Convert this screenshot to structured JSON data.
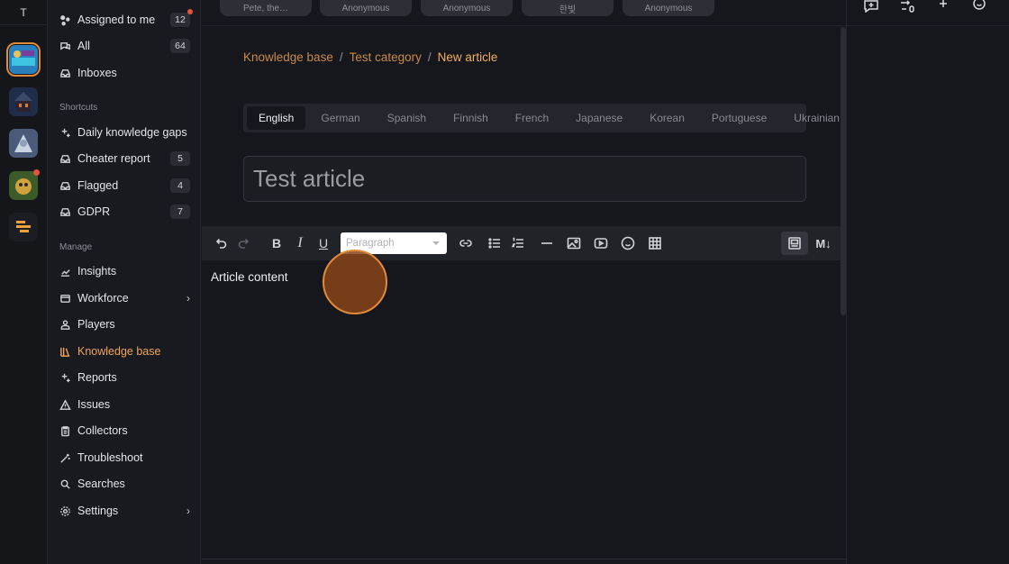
{
  "rail": {
    "top_label": "T",
    "workspaces": [
      {
        "name": "workspace-1",
        "colors": [
          "#2a7fbf",
          "#3ec3e0"
        ],
        "active": true
      },
      {
        "name": "workspace-2",
        "colors": [
          "#1f2d4a",
          "#e07b2c"
        ],
        "active": false
      },
      {
        "name": "workspace-3",
        "colors": [
          "#4a5a7a",
          "#c9d3e3"
        ],
        "active": false
      },
      {
        "name": "workspace-4",
        "colors": [
          "#3d5a2a",
          "#d2a23c"
        ],
        "active": false,
        "badge": true
      },
      {
        "name": "workspace-5",
        "colors": [
          "#1b1d22",
          "#f0a23a"
        ],
        "active": false
      }
    ]
  },
  "sidebar": {
    "top_items": [
      {
        "label": "Assigned to me",
        "count": "12",
        "icon": "dots-icon",
        "dot": true
      },
      {
        "label": "All",
        "count": "64",
        "icon": "chat-icon"
      },
      {
        "label": "Inboxes",
        "count": "",
        "icon": "inbox-icon"
      }
    ],
    "shortcuts_label": "Shortcuts",
    "shortcuts": [
      {
        "label": "Daily knowledge gaps",
        "count": "",
        "icon": "sparkle-icon"
      },
      {
        "label": "Cheater report",
        "count": "5",
        "icon": "inbox-icon"
      },
      {
        "label": "Flagged",
        "count": "4",
        "icon": "inbox-icon"
      },
      {
        "label": "GDPR",
        "count": "7",
        "icon": "inbox-icon"
      }
    ],
    "manage_label": "Manage",
    "manage": [
      {
        "label": "Insights",
        "icon": "chart-icon"
      },
      {
        "label": "Workforce",
        "icon": "window-icon",
        "chevron": true
      },
      {
        "label": "Players",
        "icon": "person-icon"
      },
      {
        "label": "Knowledge base",
        "icon": "library-icon",
        "active": true
      },
      {
        "label": "Reports",
        "icon": "sparkle-icon"
      },
      {
        "label": "Issues",
        "icon": "warning-icon"
      },
      {
        "label": "Collectors",
        "icon": "clipboard-icon"
      },
      {
        "label": "Troubleshoot",
        "icon": "wand-icon"
      },
      {
        "label": "Searches",
        "icon": "search-icon"
      },
      {
        "label": "Settings",
        "icon": "gear-icon",
        "chevron": true
      }
    ]
  },
  "topbar": {
    "chips": [
      "Pete, the…",
      "Anonymous",
      "Anonymous",
      "한빛",
      "Anonymous"
    ],
    "icons": [
      "chat-add-icon",
      "transfer-icon",
      "sparkle-icon",
      "smiley-icon"
    ]
  },
  "breadcrumb": {
    "root": "Knowledge base",
    "category": "Test category",
    "current": "New article",
    "separator": "/"
  },
  "languages": [
    "English",
    "German",
    "Spanish",
    "Finnish",
    "French",
    "Japanese",
    "Korean",
    "Portuguese",
    "Ukrainian"
  ],
  "active_language": "English",
  "title_input": {
    "placeholder": "Test article",
    "value": ""
  },
  "toolbar": {
    "paragraph_select": "Paragraph",
    "markdown_label": "M↓"
  },
  "editor": {
    "content": "Article content"
  },
  "colors": {
    "accent": "#f0a55a",
    "background": "#15171c",
    "sidebar": "#181a1f"
  }
}
